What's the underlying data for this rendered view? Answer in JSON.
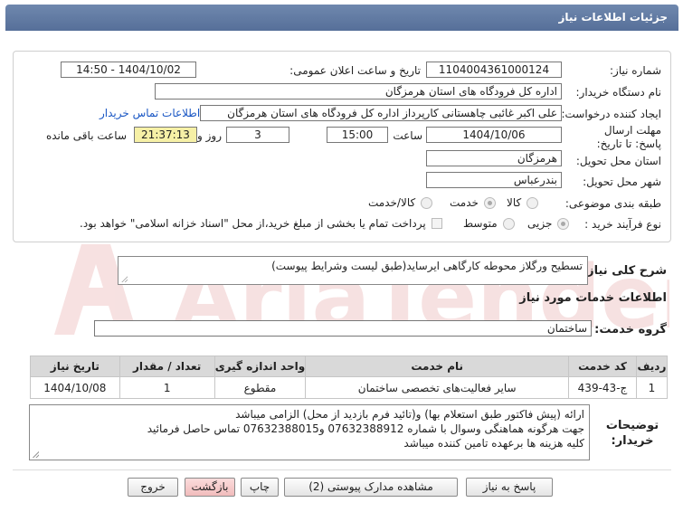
{
  "header": {
    "title": "جزئیات اطلاعات نیاز"
  },
  "form": {
    "need_number": {
      "label": "شماره نیاز:",
      "value": "1104004361000124"
    },
    "announce_datetime": {
      "label": "تاریخ و ساعت اعلان عمومی:",
      "value": "1404/10/02 - 14:50"
    },
    "buyer_org": {
      "label": "نام دستگاه خریدار:",
      "value": "اداره کل فرودگاه های استان هرمزگان"
    },
    "requester": {
      "label": "ایجاد کننده درخواست:",
      "value": "علی اکبر غائبی چاهستانی کارپرداز اداره کل فرودگاه های استان هرمزگان"
    },
    "contact_link": "اطلاعات تماس خریدار",
    "deadline": {
      "label": "مهلت ارسال پاسخ: تا تاریخ:",
      "date": "1404/10/06",
      "time_label": "ساعت",
      "time": "15:00",
      "days": "3",
      "days_label": "روز و",
      "remaining": "21:37:13",
      "remaining_label": "ساعت باقی مانده"
    },
    "province": {
      "label": "استان محل تحویل:",
      "value": "هرمزگان"
    },
    "city": {
      "label": "شهر محل تحویل:",
      "value": "بندرعباس"
    },
    "category": {
      "label": "طبقه بندی موضوعی:",
      "options": [
        "کالا",
        "خدمت",
        "کالا/خدمت"
      ],
      "selected": "خدمت"
    },
    "purchase_type": {
      "label": "نوع فرآیند خرید :",
      "options": [
        "جزیی",
        "متوسط"
      ],
      "selected": "جزیی",
      "note": "پرداخت تمام یا بخشی از مبلغ خرید،از محل \"اسناد خزانه اسلامی\" خواهد بود."
    }
  },
  "summary": {
    "label": "شرح کلی نیاز:",
    "value": "تسطیح ورگلاز محوطه کارگاهی ایرساید(طبق لیست وشرایط پیوست)"
  },
  "services": {
    "heading": "اطلاعات خدمات مورد نیاز",
    "group_label": "گروه خدمت:",
    "group_value": "ساختمان",
    "columns": [
      "ردیف",
      "کد خدمت",
      "نام خدمت",
      "واحد اندازه گیری",
      "تعداد / مقدار",
      "تاریخ نیاز"
    ],
    "rows": [
      [
        "1",
        "ج-43-439",
        "سایر فعالیت‌های تخصصی ساختمان",
        "مقطوع",
        "1",
        "1404/10/08"
      ]
    ]
  },
  "buyer_notes": {
    "label": "توضیحات خریدار:",
    "lines": [
      "ارائه (پیش فاکتور طبق استعلام بها)  و(تائید فرم بازدید از محل)  الزامی میباشد",
      "جهت هرگونه هماهنگی وسوال با شماره 07632388912 و07632388015 تماس حاصل فرمائید",
      "کلیه هزینه ها برعهده تامین کننده میباشد"
    ]
  },
  "buttons": {
    "reply": "پاسخ به نیاز",
    "attachments": "مشاهده مدارک پیوستی (2)",
    "print": "چاپ",
    "back": "بازگشت",
    "exit": "خروج"
  },
  "watermark": {
    "text": "AriaTender.net"
  },
  "colors": {
    "header_bg": "#5f78a3",
    "link": "#1a57c4",
    "highlight": "#f6f0a6",
    "watermark": "#f0c9c9"
  }
}
